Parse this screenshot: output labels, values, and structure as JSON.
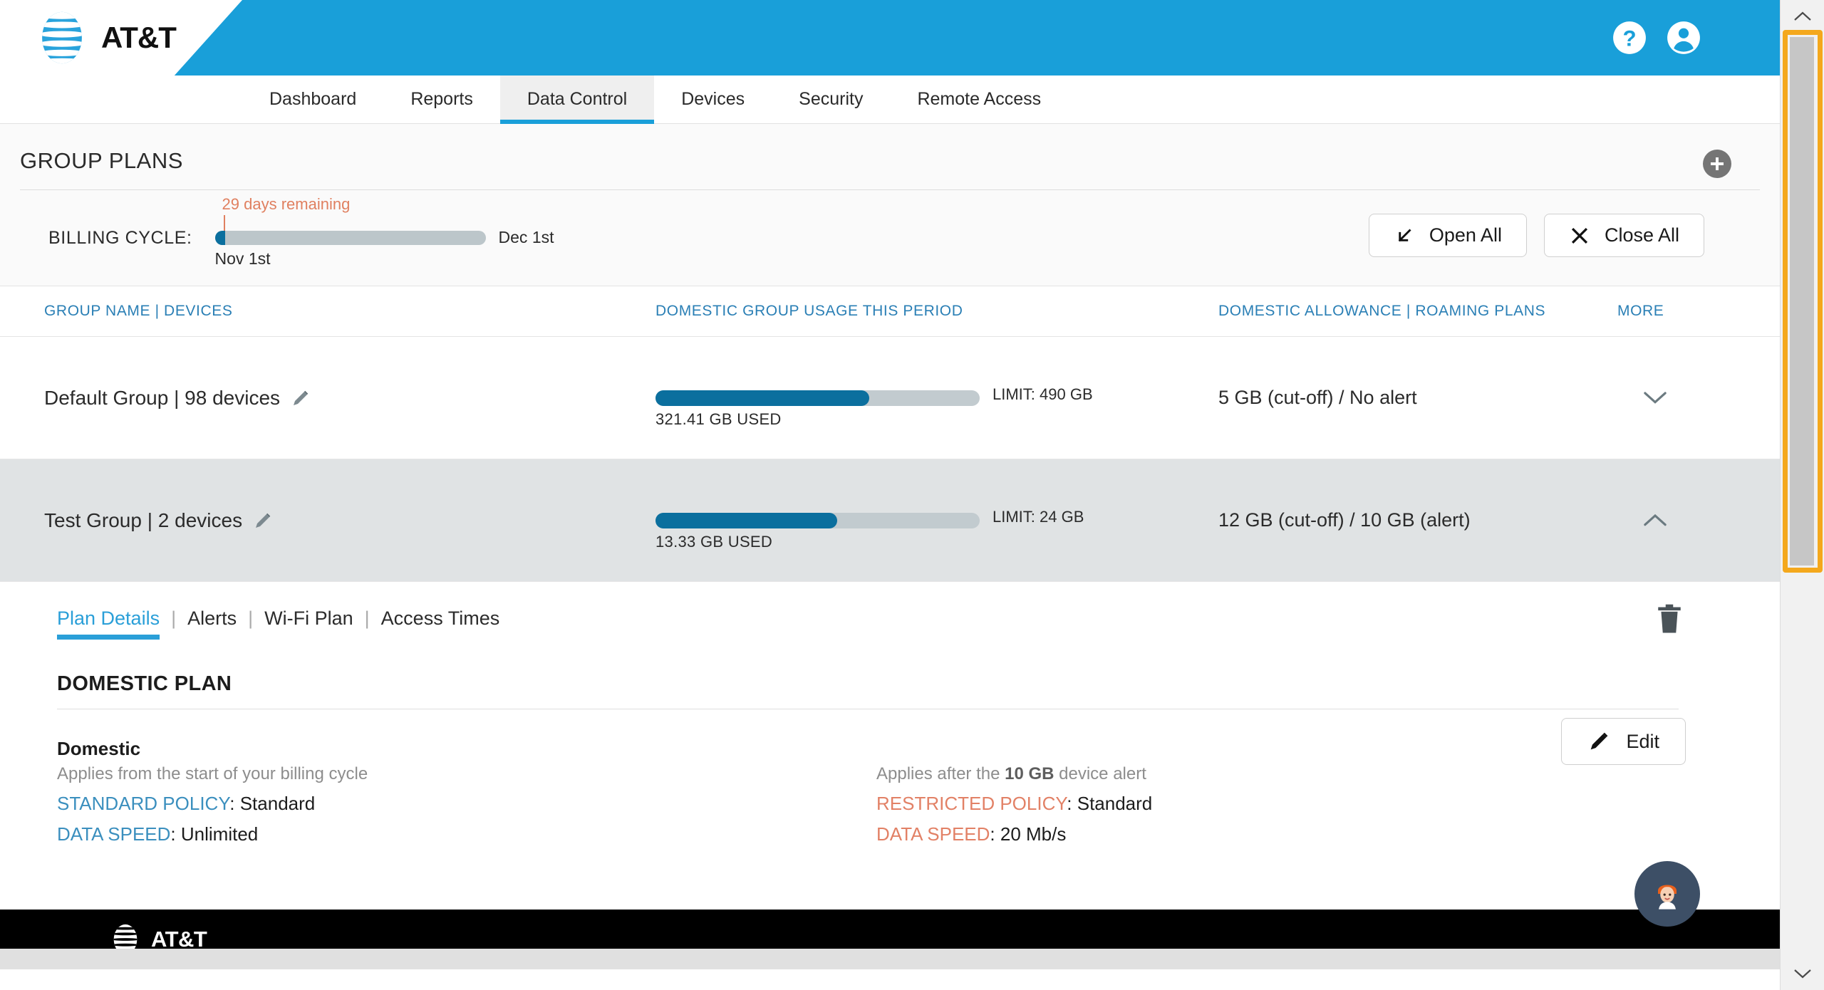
{
  "brand": {
    "name": "AT&T",
    "accent": "#199fd9",
    "dark": "#0b6f9e",
    "orange": "#e28166"
  },
  "header": {
    "help_icon": "help-circle-icon",
    "account_icon": "account-circle-icon"
  },
  "nav": {
    "tabs": [
      {
        "label": "Dashboard",
        "active": false
      },
      {
        "label": "Reports",
        "active": false
      },
      {
        "label": "Data Control",
        "active": true
      },
      {
        "label": "Devices",
        "active": false
      },
      {
        "label": "Security",
        "active": false
      },
      {
        "label": "Remote Access",
        "active": false
      }
    ]
  },
  "page": {
    "title": "GROUP PLANS",
    "add_button_label": "+"
  },
  "billing": {
    "label": "BILLING CYCLE:",
    "days_remaining": "29 days remaining",
    "start": "Nov 1st",
    "end": "Dec 1st",
    "progress_percent": 3,
    "open_all": "Open All",
    "close_all": "Close All"
  },
  "table": {
    "headers": {
      "group_name": "GROUP NAME | DEVICES",
      "usage": "DOMESTIC GROUP USAGE THIS PERIOD",
      "allowance": "DOMESTIC ALLOWANCE | ROAMING PLANS",
      "more": "MORE"
    },
    "rows": [
      {
        "name": "Default Group | 98 devices",
        "used_label": "321.41 GB USED",
        "limit_label": "LIMIT: 490 GB",
        "used_gb": 321.41,
        "limit_gb": 490,
        "fill_percent": 66,
        "allowance": "5 GB (cut-off) / No alert",
        "expanded": false,
        "chevron": "chevron-down-icon"
      },
      {
        "name": "Test Group | 2 devices",
        "used_label": "13.33 GB USED",
        "limit_label": "LIMIT: 24 GB",
        "used_gb": 13.33,
        "limit_gb": 24,
        "fill_percent": 56,
        "allowance": "12 GB (cut-off) / 10 GB (alert)",
        "expanded": true,
        "chevron": "chevron-up-icon"
      }
    ]
  },
  "detail": {
    "subtabs": [
      {
        "label": "Plan Details",
        "active": true
      },
      {
        "label": "Alerts",
        "active": false
      },
      {
        "label": "Wi-Fi Plan",
        "active": false
      },
      {
        "label": "Access Times",
        "active": false
      }
    ],
    "separator": "|",
    "delete_icon": "trash-icon",
    "plan_heading": "DOMESTIC PLAN",
    "left": {
      "title": "Domestic",
      "note": "Applies from the start of your billing cycle",
      "policy_label": "STANDARD POLICY",
      "policy_value": "Standard",
      "speed_label": "DATA SPEED",
      "speed_value": "Unlimited"
    },
    "right": {
      "note_prefix": "Applies after the ",
      "note_bold": "10 GB",
      "note_suffix": " device alert",
      "policy_label": "RESTRICTED POLICY",
      "policy_value": "Standard",
      "speed_label": "DATA SPEED",
      "speed_value": "20 Mb/s"
    },
    "edit_label": "Edit"
  },
  "footer": {
    "brand": "AT&T"
  },
  "chat": {
    "icon": "support-agent-avatar-icon"
  },
  "scrollbar": {
    "up_icon": "scroll-up-arrow-icon",
    "down_icon": "scroll-down-arrow-icon",
    "highlight_color": "#f4a81d"
  }
}
